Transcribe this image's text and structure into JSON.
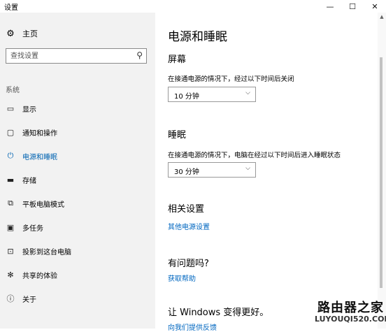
{
  "window": {
    "title": "设置",
    "minimize": "—",
    "maximize": "☐",
    "close": "✕"
  },
  "sidebar": {
    "home_label": "主页",
    "search_placeholder": "查找设置",
    "section_label": "系统",
    "items": [
      {
        "label": "显示",
        "icon": "display-icon"
      },
      {
        "label": "通知和操作",
        "icon": "notification-icon"
      },
      {
        "label": "电源和睡眠",
        "icon": "power-icon",
        "active": true
      },
      {
        "label": "存储",
        "icon": "storage-icon"
      },
      {
        "label": "平板电脑模式",
        "icon": "tablet-icon"
      },
      {
        "label": "多任务",
        "icon": "multitask-icon"
      },
      {
        "label": "投影到这台电脑",
        "icon": "project-icon"
      },
      {
        "label": "共享的体验",
        "icon": "shared-experience-icon"
      },
      {
        "label": "关于",
        "icon": "info-icon"
      }
    ],
    "accent_color": "#0063b1"
  },
  "main": {
    "title": "电源和睡眠",
    "screen": {
      "heading": "屏幕",
      "description": "在接通电源的情况下，经过以下时间后关闭",
      "value": "10 分钟"
    },
    "sleep": {
      "heading": "睡眠",
      "description": "在接通电源的情况下，电脑在经过以下时间后进入睡眠状态",
      "value": "30 分钟"
    },
    "related": {
      "heading": "相关设置",
      "link": "其他电源设置"
    },
    "question": {
      "heading": "有问题吗?",
      "link": "获取帮助"
    },
    "improve": {
      "heading": "让 Windows 变得更好。",
      "link": "向我们提供反馈"
    },
    "link_color": "#0067c0"
  },
  "watermark": {
    "cn": "路由器之家",
    "en": "LUYOUQI520.COM"
  }
}
